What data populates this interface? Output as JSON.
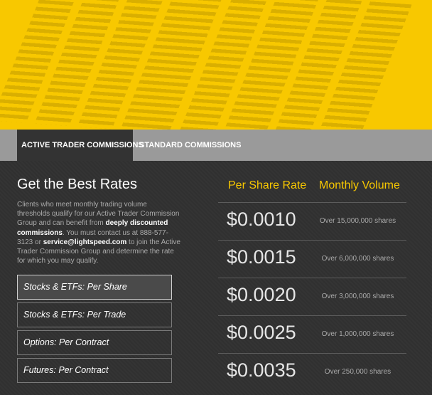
{
  "tabs": [
    {
      "label": "ACTIVE TRADER COMMISSIONS",
      "active": true
    },
    {
      "label": "STANDARD COMMISSIONS",
      "active": false
    }
  ],
  "content": {
    "heading": "Get the Best Rates",
    "desc_1": "Clients who meet monthly trading volume thresholds qualify for our Active Trader Commission Group and can benefit from ",
    "desc_bold": "deeply discounted commissions",
    "desc_2": ". You must contact us at 888-577-3123 or ",
    "desc_email": "service@lightspeed.com",
    "desc_3": " to join the Active Trader Commission Group and determine the rate for which you may qualify."
  },
  "options": [
    {
      "label": "Stocks & ETFs: Per Share",
      "selected": true
    },
    {
      "label": "Stocks & ETFs: Per Trade",
      "selected": false
    },
    {
      "label": "Options: Per Contract",
      "selected": false
    },
    {
      "label": "Futures: Per Contract",
      "selected": false
    }
  ],
  "table": {
    "headers": {
      "rate": "Per Share Rate",
      "volume": "Monthly Volume"
    },
    "rows": [
      {
        "rate": "$0.0010",
        "volume": "Over 15,000,000 shares"
      },
      {
        "rate": "$0.0015",
        "volume": "Over 6,000,000 shares"
      },
      {
        "rate": "$0.0020",
        "volume": "Over 3,000,000 shares"
      },
      {
        "rate": "$0.0025",
        "volume": "Over 1,000,000 shares"
      },
      {
        "rate": "$0.0035",
        "volume": "Over 250,000 shares"
      }
    ]
  },
  "colors": {
    "accent": "#f8c800",
    "background": "#333333",
    "tab_bar": "#9a9a9a"
  }
}
